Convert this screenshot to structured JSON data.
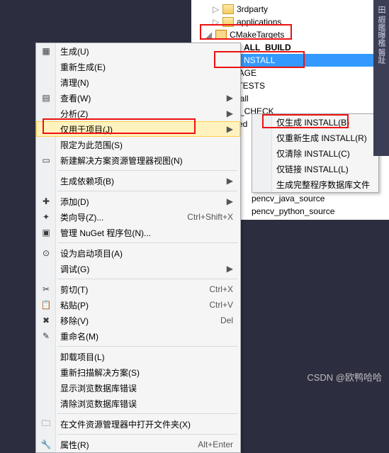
{
  "tree": {
    "items": [
      {
        "label": "3rdparty",
        "indent": 20,
        "icon": "folder",
        "arrow": "▷"
      },
      {
        "label": "applications",
        "indent": 20,
        "icon": "folder",
        "arrow": "▷"
      },
      {
        "label": "CMakeTargets",
        "indent": 10,
        "icon": "folder-red",
        "arrow": "◢",
        "boxed": true
      },
      {
        "label": "ALL_BUILD",
        "indent": 30,
        "icon": "proj",
        "arrow": "▷",
        "bold": true
      },
      {
        "label": "INSTALL",
        "indent": 30,
        "icon": "proj",
        "arrow": "▷",
        "selected": true,
        "boxed": true,
        "partial": "NSTALL"
      },
      {
        "label": "CKAGE",
        "indent": 30,
        "partial": "CKAGE"
      },
      {
        "label": "N_TESTS",
        "indent": 30,
        "partial": "N_TESTS"
      },
      {
        "label": "install",
        "indent": 30,
        "partial": "install"
      },
      {
        "label": "RO_CHECK",
        "indent": 30,
        "partial": "RO_CHECK"
      },
      {
        "label": "tched",
        "indent": 30,
        "partial": "tched"
      }
    ]
  },
  "menu1": {
    "groups": [
      [
        {
          "l": "生成(U)",
          "i": "build"
        },
        {
          "l": "重新生成(E)"
        },
        {
          "l": "清理(N)"
        },
        {
          "l": "查看(W)",
          "i": "view",
          "sub": true
        },
        {
          "l": "分析(Z)",
          "sub": true
        },
        {
          "l": "仅用于项目(J)",
          "sub": true,
          "hl": true,
          "boxed": true
        },
        {
          "l": "限定为此范围(S)"
        },
        {
          "l": "新建解决方案资源管理器视图(N)",
          "i": "newview"
        }
      ],
      [
        {
          "l": "生成依赖项(B)",
          "sub": true
        }
      ],
      [
        {
          "l": "添加(D)",
          "i": "add",
          "sub": true
        },
        {
          "l": "类向导(Z)...",
          "i": "wiz",
          "sc": "Ctrl+Shift+X"
        },
        {
          "l": "管理 NuGet 程序包(N)...",
          "i": "nuget"
        }
      ],
      [
        {
          "l": "设为启动项目(A)",
          "i": "startup"
        },
        {
          "l": "调试(G)",
          "sub": true
        }
      ],
      [
        {
          "l": "剪切(T)",
          "i": "cut",
          "sc": "Ctrl+X"
        },
        {
          "l": "粘贴(P)",
          "i": "paste",
          "sc": "Ctrl+V"
        },
        {
          "l": "移除(V)",
          "i": "del",
          "sc": "Del"
        },
        {
          "l": "重命名(M)",
          "i": "ren"
        }
      ],
      [
        {
          "l": "卸载项目(L)"
        },
        {
          "l": "重新扫描解决方案(S)"
        },
        {
          "l": "显示浏览数据库错误"
        },
        {
          "l": "清除浏览数据库错误"
        }
      ],
      [
        {
          "l": "在文件资源管理器中打开文件夹(X)",
          "i": "explorer"
        }
      ],
      [
        {
          "l": "属性(R)",
          "i": "prop",
          "sc": "Alt+Enter"
        }
      ]
    ]
  },
  "menu2": {
    "items": [
      {
        "l": "仅生成 INSTALL(B)",
        "boxed": true
      },
      {
        "l": "仅重新生成 INSTALL(R)"
      },
      {
        "l": "仅清除 INSTALL(C)"
      },
      {
        "l": "仅链接 INSTALL(L)"
      },
      {
        "l": "生成完整程序数据库文件"
      }
    ]
  },
  "below": {
    "items": [
      "pencv_java_source",
      "pencv_python_source"
    ]
  },
  "watermark": "CSDN @欧鸭哈哈"
}
